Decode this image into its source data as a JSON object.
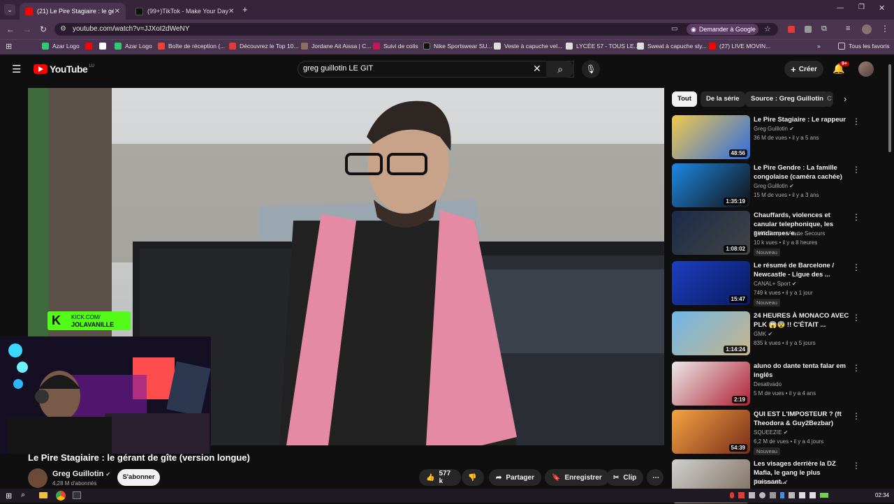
{
  "browser": {
    "tabs": [
      {
        "title": "(21) Le Pire Stagiaire : le gérant",
        "favicon_color": "#ff0000",
        "active": true
      },
      {
        "title": "(99+)TikTok - Make Your Day",
        "favicon_color": "#111111",
        "active": false
      }
    ],
    "url": "youtube.com/watch?v=JJXoI2dWeNY",
    "gemini_button": "Demander à Google",
    "bookmarks": [
      {
        "label": "Azar Logo",
        "color": "#2ecc71"
      },
      {
        "label": "",
        "color": "#ff0000"
      },
      {
        "label": "",
        "color": "#ffffff"
      },
      {
        "label": "Azar Logo",
        "color": "#2ecc71"
      },
      {
        "label": "Boîte de réception (...",
        "color": "#ea4335"
      },
      {
        "label": "Découvrez le Top 10...",
        "color": "#e53935"
      },
      {
        "label": "Jordane Ait Aissa | C...",
        "color": "#8d6e63"
      },
      {
        "label": "Suivi de colis",
        "color": "#c2185b"
      },
      {
        "label": "Nike Sportswear SU...",
        "color": "#111111"
      },
      {
        "label": "Veste à capuche vel...",
        "color": "#dddddd"
      },
      {
        "label": "LYCÉE 57 - TOUS LE...",
        "color": "#dddddd"
      },
      {
        "label": "Sweat à capuche sty...",
        "color": "#dddddd"
      },
      {
        "label": "(27) LIVE MOVIN...",
        "color": "#ff0000"
      }
    ],
    "all_favorites": "Tous les favoris"
  },
  "youtube": {
    "logo": "YouTube",
    "logo_sup": "LU",
    "search_query": "greg guillotin LE GIT",
    "create_label": "Créer",
    "notif_count": "9+"
  },
  "video": {
    "title": "Le Pire Stagiaire : le gérant de gîte (version longue)",
    "channel": "Greg Guillotin",
    "subscribers": "4,28 M d'abonnés",
    "subscribe_label": "S'abonner",
    "likes": "577 k",
    "share_label": "Partager",
    "save_label": "Enregistrer",
    "clip_label": "Clip",
    "kick_overlay": {
      "line1": "KICK.COM/",
      "line2": "JOLAVANILLE"
    }
  },
  "chips": [
    "Tout",
    "De la série",
    "Source : Greg Guillotin",
    "C"
  ],
  "recommendations": [
    {
      "title": "Le Pire Stagiaire : Le rappeur",
      "channel": "Greg Guillotin",
      "verified": true,
      "meta": "36 M de vues • il y a 5 ans",
      "duration": "48:56",
      "badge": "",
      "colors": [
        "#f2c94c",
        "#2d6cdf"
      ]
    },
    {
      "title": "Le Pire Gendre : La famille congolaise (caméra cachée)",
      "channel": "Greg Guillotin",
      "verified": true,
      "meta": "15 M de vues • il y a 3 ans",
      "duration": "1:35:19",
      "badge": "",
      "colors": [
        "#1e88e5",
        "#111111"
      ]
    },
    {
      "title": "Chauffards, violences et canular telephonique, les gendarmes e...",
      "channel": "RMC Story et Alerte Secours",
      "verified": false,
      "meta": "10 k vues • il y a 8 heures",
      "duration": "1:08:02",
      "badge": "Nouveau",
      "colors": [
        "#1a2a4a",
        "#444444"
      ]
    },
    {
      "title": "Le résumé de Barcelone / Newcastle - Ligue des ...",
      "channel": "CANAL+ Sport",
      "verified": true,
      "meta": "749 k vues • il y a 1 jour",
      "duration": "15:47",
      "badge": "Nouveau",
      "colors": [
        "#1d3fbf",
        "#0a1a60"
      ]
    },
    {
      "title": "24 HEURES À MONACO AVEC PLK 😱😨 !! C'ÉTAIT ...",
      "channel": "GMK",
      "verified": true,
      "meta": "835 k vues • il y a 5 jours",
      "duration": "1:14:24",
      "badge": "",
      "colors": [
        "#6fb7e8",
        "#c9b48a"
      ]
    },
    {
      "title": "aluno do dante tenta falar em inglês",
      "channel": "Desativado",
      "verified": false,
      "meta": "5 M de vues • il y a 4 ans",
      "duration": "2:19",
      "badge": "",
      "colors": [
        "#e8e8e8",
        "#b22234"
      ]
    },
    {
      "title": "QUI EST L'IMPOSTEUR ? (ft Theodora & Guy2Bezbar)",
      "channel": "SQUEEZIE",
      "verified": true,
      "meta": "6,2 M de vues • il y a 4 jours",
      "duration": "54:39",
      "badge": "Nouveau",
      "colors": [
        "#f4a340",
        "#7a2d1a"
      ]
    },
    {
      "title": "Les visages derrière la DZ Mafia, le gang le plus puissant...",
      "channel": "Réel média",
      "verified": true,
      "meta": "",
      "duration": "",
      "badge": "",
      "colors": [
        "#d0d0d0",
        "#7a6a5a"
      ]
    }
  ],
  "taskbar": {
    "time": "02:34"
  }
}
